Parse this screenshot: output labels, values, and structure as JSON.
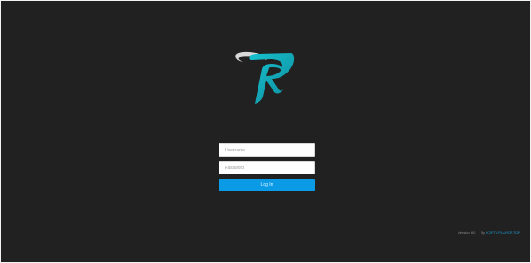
{
  "login": {
    "username_placeholder": "Username",
    "password_placeholder": "Password",
    "login_button_label": "Log In"
  },
  "footer": {
    "version": "Version 6.0",
    "credit_prefix": "By",
    "credit_link": "KOFTV.PLAYER.TOP"
  },
  "logo": {
    "icon": "r-brand-logo",
    "colors": {
      "gradient_start": "#17c3cf",
      "gradient_end": "#0f8c9e",
      "swoosh": "#d9d9d9"
    }
  },
  "colors": {
    "background": "#212121",
    "accent": "#0b9be6",
    "link": "#1d9fd8"
  }
}
